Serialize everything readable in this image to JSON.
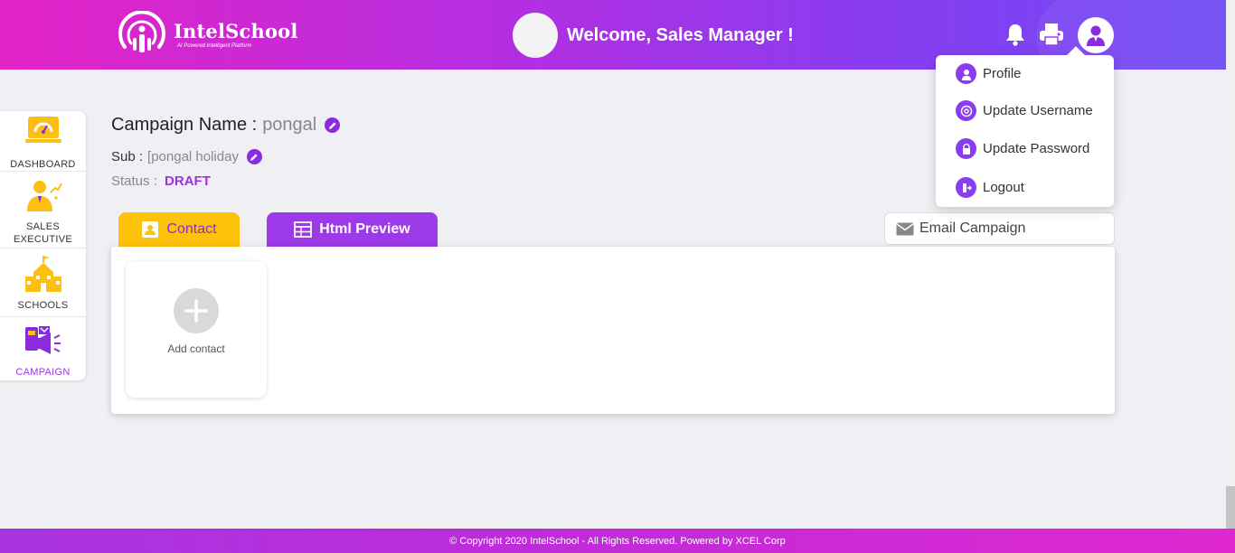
{
  "header": {
    "logo_name": "IntelSchool",
    "logo_tagline": "AI Powered Intelligent Platform",
    "welcome": "Welcome, Sales Manager !",
    "icons": [
      "bell-icon",
      "printer-icon",
      "user-icon"
    ]
  },
  "user_menu": {
    "items": [
      {
        "label": "Profile",
        "icon": "profile-icon"
      },
      {
        "label": "Update Username",
        "icon": "at-icon"
      },
      {
        "label": "Update Password",
        "icon": "lock-icon"
      },
      {
        "label": "Logout",
        "icon": "logout-icon"
      }
    ]
  },
  "sidebar": {
    "items": [
      {
        "label": "DASHBOARD",
        "icon": "dashboard-icon"
      },
      {
        "label": "SALES EXECUTIVE",
        "icon": "sales-executive-icon"
      },
      {
        "label": "SCHOOLS",
        "icon": "school-icon"
      },
      {
        "label": "CAMPAIGN",
        "icon": "campaign-icon",
        "active": true
      }
    ]
  },
  "campaign": {
    "name_label": "Campaign Name :",
    "name_value": "pongal",
    "sub_label": "Sub :",
    "sub_value": "[pongal holiday",
    "status_label": "Status :",
    "status_value": "DRAFT"
  },
  "tabs": {
    "contact": "Contact",
    "html_preview": "Html Preview"
  },
  "email_campaign": "Email Campaign",
  "panel": {
    "add_contact": "Add contact"
  },
  "footer": {
    "copyright": "© Copyright 2020 IntelSchool - All Rights Reserved. Powered by XCEL Corp"
  },
  "colors": {
    "header_start": "#e324c6",
    "header_end": "#6e4bf5",
    "accent_purple": "#9d3ae8",
    "accent_yellow": "#fdc20a"
  }
}
